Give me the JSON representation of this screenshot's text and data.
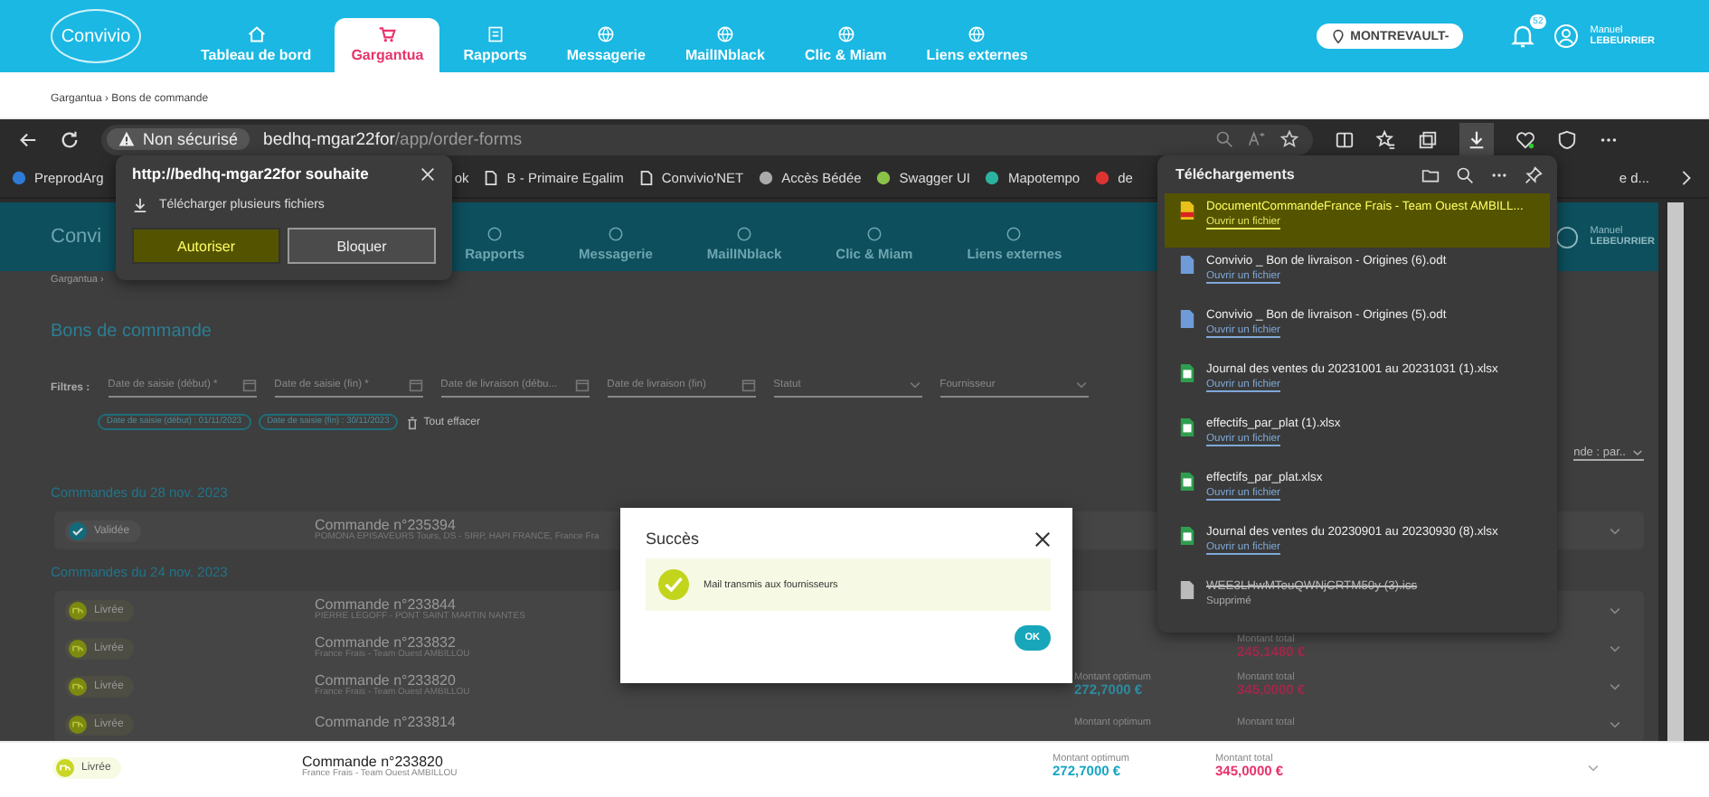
{
  "app_header": {
    "logo": "Convivio",
    "nav": [
      {
        "label": "Tableau de bord",
        "selected": false
      },
      {
        "label": "Gargantua",
        "selected": true
      },
      {
        "label": "Rapports",
        "selected": false
      },
      {
        "label": "Messagerie",
        "selected": false
      },
      {
        "label": "MailINblack",
        "selected": false
      },
      {
        "label": "Clic & Miam",
        "selected": false
      },
      {
        "label": "Liens externes",
        "selected": false
      }
    ],
    "location": "MONTREVAULT-",
    "notifications": "52",
    "user_first": "Manuel",
    "user_last": "LEBEURRIER"
  },
  "breadcrumb": "Gargantua › Bons de commande",
  "browser": {
    "security": "Non sécurisé",
    "url_host": "bedhq-mgar22for",
    "url_path": "/app/order-forms",
    "bookmarks": [
      "PreprodArg",
      "ok",
      "B - Primaire Egalim",
      "Convivio'NET",
      "Accès Bédée",
      "Swagger UI",
      "Mapotempo",
      "de"
    ],
    "bookmark_tail": "e d..."
  },
  "permission_popup": {
    "title": "http://bedhq-mgar22for souhaite",
    "request": "Télécharger plusieurs fichiers",
    "buttons": [
      {
        "label": "Autoriser",
        "selected": true
      },
      {
        "label": "Bloquer",
        "selected": false
      }
    ]
  },
  "downloads": {
    "title": "Téléchargements",
    "items": [
      {
        "kind": "pdf",
        "name": "DocumentCommandeFrance Frais - Team Ouest AMBILL...",
        "action": "Ouvrir un fichier",
        "selected": true,
        "deleted": false
      },
      {
        "kind": "odt",
        "name": "Convivio _ Bon de livraison - Origines (6).odt",
        "action": "Ouvrir un fichier",
        "selected": false,
        "deleted": false
      },
      {
        "kind": "odt",
        "name": "Convivio _ Bon de livraison - Origines (5).odt",
        "action": "Ouvrir un fichier",
        "selected": false,
        "deleted": false
      },
      {
        "kind": "xlsx",
        "name": "Journal des ventes du 20231001 au 20231031 (1).xlsx",
        "action": "Ouvrir un fichier",
        "selected": false,
        "deleted": false
      },
      {
        "kind": "xlsx",
        "name": "effectifs_par_plat (1).xlsx",
        "action": "Ouvrir un fichier",
        "selected": false,
        "deleted": false
      },
      {
        "kind": "xlsx",
        "name": "effectifs_par_plat.xlsx",
        "action": "Ouvrir un fichier",
        "selected": false,
        "deleted": false
      },
      {
        "kind": "xlsx",
        "name": "Journal des ventes du 20230901 au 20230930 (8).xlsx",
        "action": "Ouvrir un fichier",
        "selected": false,
        "deleted": false
      },
      {
        "kind": "ics",
        "name": "WEE3LHwMTeuQWNjCRTM50y (3).ics",
        "action": "Supprimé",
        "selected": false,
        "deleted": true
      }
    ]
  },
  "page": {
    "inner_logo": "Convi",
    "inner_breadcrumb": "Gargantua ›",
    "inner_nav": [
      "Rapports",
      "Messagerie",
      "MailINblack",
      "Clic & Miam",
      "Liens externes"
    ],
    "inner_user_first": "Manuel",
    "inner_user_last": "LEBEURRIER",
    "title": "Bons de commande",
    "filters_label": "Filtres :",
    "filters": [
      {
        "placeholder": "Date de saisie (début) *",
        "kind": "date"
      },
      {
        "placeholder": "Date de saisie (fin) *",
        "kind": "date"
      },
      {
        "placeholder": "Date de livraison (débu...",
        "kind": "date"
      },
      {
        "placeholder": "Date de livraison (fin)",
        "kind": "date"
      },
      {
        "placeholder": "Statut",
        "kind": "select"
      },
      {
        "placeholder": "Fournisseur",
        "kind": "select"
      }
    ],
    "chips": [
      "Date de saisie (début) : 01/11/2023",
      "Date de saisie (fin) : 30/11/2023"
    ],
    "clear_all": "Tout effacer",
    "sort_field": "nde : par..",
    "groups": [
      {
        "title": "Commandes du 28 nov. 2023",
        "orders": [
          {
            "kind": "validated",
            "status": "Validée",
            "number": "Commande n°235394",
            "supplier": "POMONA EPISAVEURS Tours, DS - SIRP, HAPI FRANCE, France Fra"
          }
        ]
      },
      {
        "title": "Commandes du 24 nov. 2023",
        "orders": [
          {
            "kind": "delivered",
            "status": "Livrée",
            "number": "Commande n°233844",
            "supplier": "PIERRE LEGOFF - PONT SAINT MARTIN NANTES"
          },
          {
            "kind": "delivered",
            "status": "Livrée",
            "number": "Commande n°233832",
            "supplier": "France Frais - Team Ouest AMBILLOU",
            "total_label": "Montant total",
            "total": "245,1480 €"
          },
          {
            "kind": "delivered",
            "status": "Livrée",
            "number": "Commande n°233820",
            "supplier": "France Frais - Team Ouest AMBILLOU",
            "optimum_label": "Montant optimum",
            "optimum": "272,7000 €",
            "total_label": "Montant total",
            "total": "345,0000 €"
          },
          {
            "kind": "delivered",
            "status": "Livrée",
            "number": "Commande n°233814",
            "optimum_label": "Montant optimum",
            "total_label": "Montant total"
          }
        ]
      }
    ]
  },
  "modal": {
    "title": "Succès",
    "message": "Mail transmis aux fournisseurs",
    "button": "OK"
  },
  "bottom_row": {
    "kind": "delivered",
    "status": "Livrée",
    "number": "Commande n°233820",
    "supplier": "France Frais - Team Ouest AMBILLOU",
    "optimum_label": "Montant optimum",
    "optimum": "272,7000 €",
    "total_label": "Montant total",
    "total": "345,0000 €"
  }
}
